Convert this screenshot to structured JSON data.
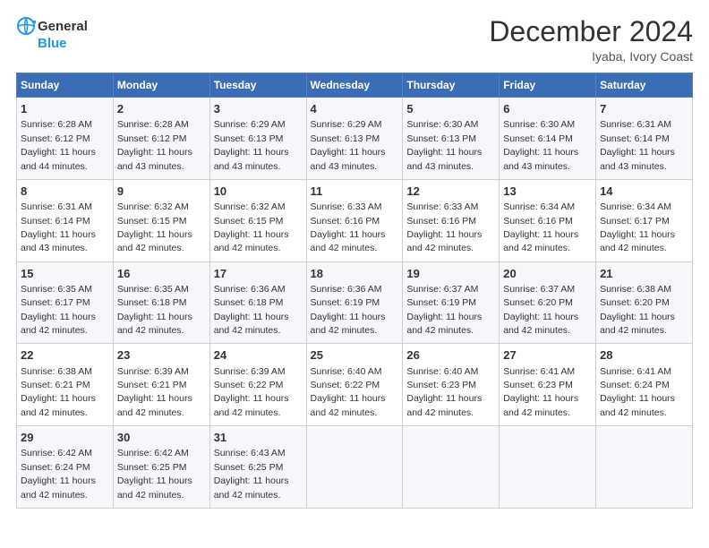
{
  "header": {
    "logo_line1": "General",
    "logo_line2": "Blue",
    "title": "December 2024",
    "subtitle": "Iyaba, Ivory Coast"
  },
  "weekdays": [
    "Sunday",
    "Monday",
    "Tuesday",
    "Wednesday",
    "Thursday",
    "Friday",
    "Saturday"
  ],
  "weeks": [
    [
      {
        "day": 1,
        "sunrise": "6:28 AM",
        "sunset": "6:12 PM",
        "daylight": "11 hours and 44 minutes."
      },
      {
        "day": 2,
        "sunrise": "6:28 AM",
        "sunset": "6:12 PM",
        "daylight": "11 hours and 43 minutes."
      },
      {
        "day": 3,
        "sunrise": "6:29 AM",
        "sunset": "6:13 PM",
        "daylight": "11 hours and 43 minutes."
      },
      {
        "day": 4,
        "sunrise": "6:29 AM",
        "sunset": "6:13 PM",
        "daylight": "11 hours and 43 minutes."
      },
      {
        "day": 5,
        "sunrise": "6:30 AM",
        "sunset": "6:13 PM",
        "daylight": "11 hours and 43 minutes."
      },
      {
        "day": 6,
        "sunrise": "6:30 AM",
        "sunset": "6:14 PM",
        "daylight": "11 hours and 43 minutes."
      },
      {
        "day": 7,
        "sunrise": "6:31 AM",
        "sunset": "6:14 PM",
        "daylight": "11 hours and 43 minutes."
      }
    ],
    [
      {
        "day": 8,
        "sunrise": "6:31 AM",
        "sunset": "6:14 PM",
        "daylight": "11 hours and 43 minutes."
      },
      {
        "day": 9,
        "sunrise": "6:32 AM",
        "sunset": "6:15 PM",
        "daylight": "11 hours and 42 minutes."
      },
      {
        "day": 10,
        "sunrise": "6:32 AM",
        "sunset": "6:15 PM",
        "daylight": "11 hours and 42 minutes."
      },
      {
        "day": 11,
        "sunrise": "6:33 AM",
        "sunset": "6:16 PM",
        "daylight": "11 hours and 42 minutes."
      },
      {
        "day": 12,
        "sunrise": "6:33 AM",
        "sunset": "6:16 PM",
        "daylight": "11 hours and 42 minutes."
      },
      {
        "day": 13,
        "sunrise": "6:34 AM",
        "sunset": "6:16 PM",
        "daylight": "11 hours and 42 minutes."
      },
      {
        "day": 14,
        "sunrise": "6:34 AM",
        "sunset": "6:17 PM",
        "daylight": "11 hours and 42 minutes."
      }
    ],
    [
      {
        "day": 15,
        "sunrise": "6:35 AM",
        "sunset": "6:17 PM",
        "daylight": "11 hours and 42 minutes."
      },
      {
        "day": 16,
        "sunrise": "6:35 AM",
        "sunset": "6:18 PM",
        "daylight": "11 hours and 42 minutes."
      },
      {
        "day": 17,
        "sunrise": "6:36 AM",
        "sunset": "6:18 PM",
        "daylight": "11 hours and 42 minutes."
      },
      {
        "day": 18,
        "sunrise": "6:36 AM",
        "sunset": "6:19 PM",
        "daylight": "11 hours and 42 minutes."
      },
      {
        "day": 19,
        "sunrise": "6:37 AM",
        "sunset": "6:19 PM",
        "daylight": "11 hours and 42 minutes."
      },
      {
        "day": 20,
        "sunrise": "6:37 AM",
        "sunset": "6:20 PM",
        "daylight": "11 hours and 42 minutes."
      },
      {
        "day": 21,
        "sunrise": "6:38 AM",
        "sunset": "6:20 PM",
        "daylight": "11 hours and 42 minutes."
      }
    ],
    [
      {
        "day": 22,
        "sunrise": "6:38 AM",
        "sunset": "6:21 PM",
        "daylight": "11 hours and 42 minutes."
      },
      {
        "day": 23,
        "sunrise": "6:39 AM",
        "sunset": "6:21 PM",
        "daylight": "11 hours and 42 minutes."
      },
      {
        "day": 24,
        "sunrise": "6:39 AM",
        "sunset": "6:22 PM",
        "daylight": "11 hours and 42 minutes."
      },
      {
        "day": 25,
        "sunrise": "6:40 AM",
        "sunset": "6:22 PM",
        "daylight": "11 hours and 42 minutes."
      },
      {
        "day": 26,
        "sunrise": "6:40 AM",
        "sunset": "6:23 PM",
        "daylight": "11 hours and 42 minutes."
      },
      {
        "day": 27,
        "sunrise": "6:41 AM",
        "sunset": "6:23 PM",
        "daylight": "11 hours and 42 minutes."
      },
      {
        "day": 28,
        "sunrise": "6:41 AM",
        "sunset": "6:24 PM",
        "daylight": "11 hours and 42 minutes."
      }
    ],
    [
      {
        "day": 29,
        "sunrise": "6:42 AM",
        "sunset": "6:24 PM",
        "daylight": "11 hours and 42 minutes."
      },
      {
        "day": 30,
        "sunrise": "6:42 AM",
        "sunset": "6:25 PM",
        "daylight": "11 hours and 42 minutes."
      },
      {
        "day": 31,
        "sunrise": "6:43 AM",
        "sunset": "6:25 PM",
        "daylight": "11 hours and 42 minutes."
      },
      null,
      null,
      null,
      null
    ]
  ]
}
